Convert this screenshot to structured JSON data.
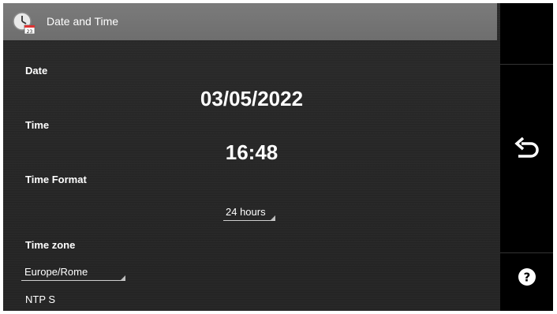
{
  "header": {
    "title": "Date and Time",
    "icon": "clock-calendar-icon",
    "icon_badge": "23"
  },
  "date": {
    "label": "Date",
    "value": "03/05/2022"
  },
  "time": {
    "label": "Time",
    "value": "16:48"
  },
  "time_format": {
    "label": "Time Format",
    "selected": "24 hours"
  },
  "time_zone": {
    "label": "Time zone",
    "selected": "Europe/Rome"
  },
  "cutoff_text": "NTP S",
  "rail": {
    "back_icon": "back-arrow-icon",
    "help_icon": "help-icon"
  }
}
